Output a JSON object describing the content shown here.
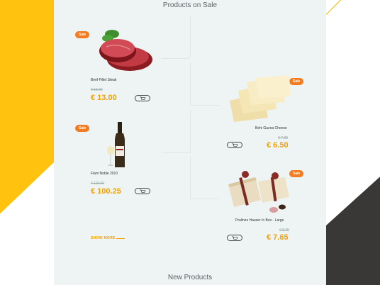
{
  "sections": {
    "on_sale_title": "Products on Sale",
    "new_products_title": "New Products"
  },
  "products": [
    {
      "name": "Beef Fillet Steak",
      "old_price": "€ 15.00",
      "price": "€ 13.00",
      "badge": "Sale"
    },
    {
      "name": "Behi Gazna Cheese",
      "old_price": "€ 7.20",
      "price": "€ 6.50",
      "badge": "Sale"
    },
    {
      "name": "Flam Noble 2010",
      "old_price": "€ 115.00",
      "price": "€ 100.25",
      "badge": "Sale"
    },
    {
      "name": "Pralines Hauser In Box - Large",
      "old_price": "€ 8.25",
      "price": "€ 7.65",
      "badge": "Sale"
    }
  ],
  "show_more_label": "SHOW MORE",
  "colors": {
    "accent": "#f4a000",
    "badge": "#f47b20",
    "yellow": "#ffc20e",
    "dark": "#3a3836"
  },
  "icons": {
    "cart": "cart-icon"
  }
}
